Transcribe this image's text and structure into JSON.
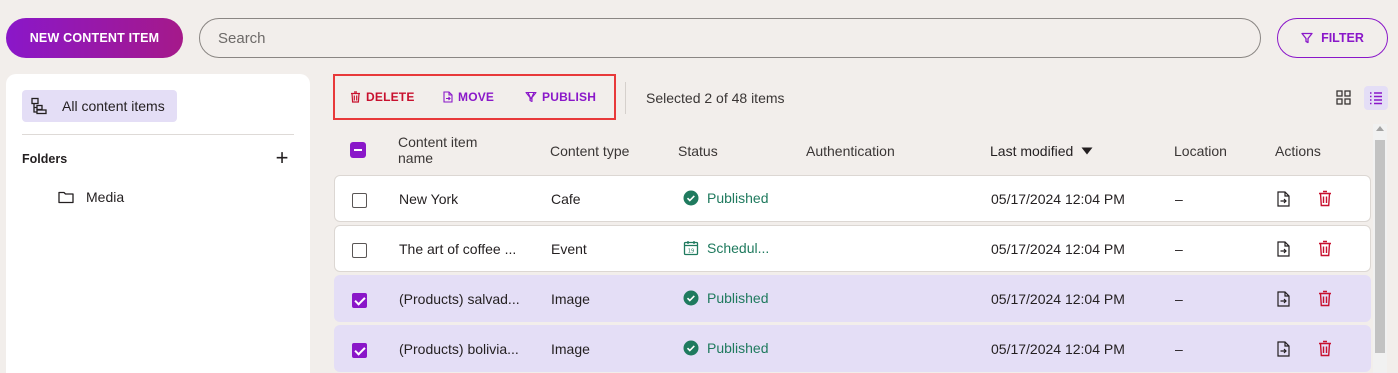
{
  "topbar": {
    "new_button": "NEW CONTENT ITEM",
    "search_placeholder": "Search",
    "filter_button": "FILTER"
  },
  "sidebar": {
    "all_items_label": "All content items",
    "folders_label": "Folders",
    "add_folder_glyph": "+",
    "folders": [
      {
        "label": "Media"
      }
    ]
  },
  "toolbar": {
    "delete_label": "DELETE",
    "move_label": "MOVE",
    "publish_label": "PUBLISH",
    "selection_text": "Selected 2 of 48 items"
  },
  "table": {
    "columns": {
      "name_line1": "Content item",
      "name_line2": "name",
      "type": "Content type",
      "status": "Status",
      "auth": "Authentication",
      "modified": "Last modified",
      "location": "Location",
      "actions": "Actions"
    },
    "rows": [
      {
        "name": "New York",
        "type": "Cafe",
        "status": "Published",
        "status_icon": "check-circle-icon",
        "auth": "",
        "modified": "05/17/2024 12:04 PM",
        "location": "–",
        "selected": false
      },
      {
        "name": "The art of coffee ...",
        "type": "Event",
        "status": "Schedul...",
        "status_icon": "calendar-icon",
        "auth": "",
        "modified": "05/17/2024 12:04 PM",
        "location": "–",
        "selected": false
      },
      {
        "name": "(Products) salvad...",
        "type": "Image",
        "status": "Published",
        "status_icon": "check-circle-icon",
        "auth": "",
        "modified": "05/17/2024 12:04 PM",
        "location": "–",
        "selected": true
      },
      {
        "name": "(Products) bolivia...",
        "type": "Image",
        "status": "Published",
        "status_icon": "check-circle-icon",
        "auth": "",
        "modified": "05/17/2024 12:04 PM",
        "location": "–",
        "selected": true
      }
    ]
  },
  "colors": {
    "accent": "#8a17c9",
    "danger": "#c8102e",
    "success": "#1f7a5e",
    "selected_row": "#e4def6",
    "highlight_border": "#e8393a"
  }
}
